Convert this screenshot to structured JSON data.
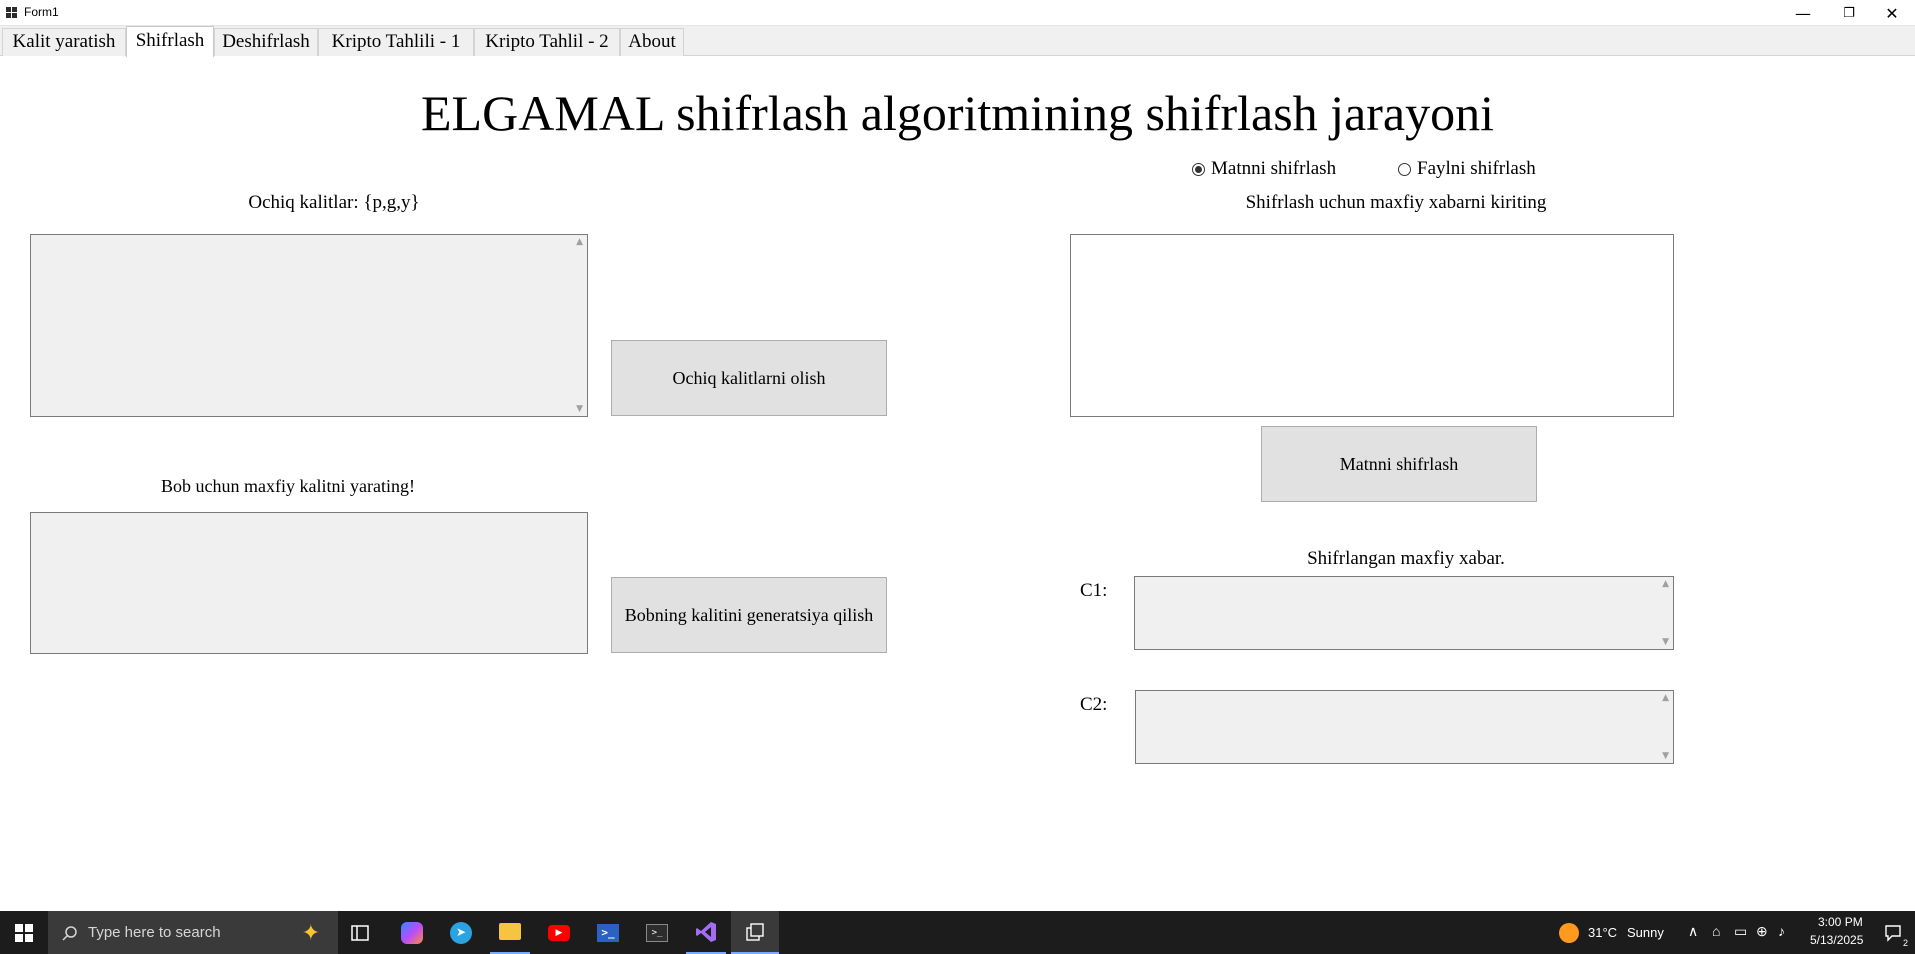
{
  "window": {
    "title": "Form1",
    "minimize_glyph": "—",
    "maximize_glyph": "❐",
    "close_glyph": "✕"
  },
  "tabs": [
    {
      "label": "Kalit yaratish",
      "active": false
    },
    {
      "label": "Shifrlash",
      "active": true
    },
    {
      "label": "Deshifrlash",
      "active": false
    },
    {
      "label": "Kripto Tahlili - 1",
      "active": false
    },
    {
      "label": "Kripto Tahlil - 2",
      "active": false
    },
    {
      "label": "About",
      "active": false
    }
  ],
  "main": {
    "title": "ELGAMAL shifrlash algoritmining shifrlash jarayoni",
    "left": {
      "public_keys_label": "Ochiq kalitlar: {p,g,y}",
      "public_keys_value": "",
      "get_public_keys_button": "Ochiq kalitlarni olish",
      "bob_key_label": "Bob uchun maxfiy kalitni yarating!",
      "bob_key_value": "",
      "generate_bob_key_button": "Bobning kalitini generatsiya qilish"
    },
    "right": {
      "mode_text": "Matnni shifrlash",
      "mode_file": "Faylni shifrlash",
      "selected_mode": "text",
      "message_label": "Shifrlash uchun maxfiy xabarni kiriting",
      "message_value": "",
      "encrypt_button": "Matnni shifrlash",
      "ciphertext_label": "Shifrlangan maxfiy xabar.",
      "c1_label": "C1:",
      "c1_value": "",
      "c2_label": "C2:",
      "c2_value": ""
    }
  },
  "taskbar": {
    "search_placeholder": "Type here to search",
    "weather_temp": "31°C",
    "weather_text": "Sunny",
    "time": "3:00 PM",
    "date": "5/13/2025",
    "notification_count": "2"
  }
}
